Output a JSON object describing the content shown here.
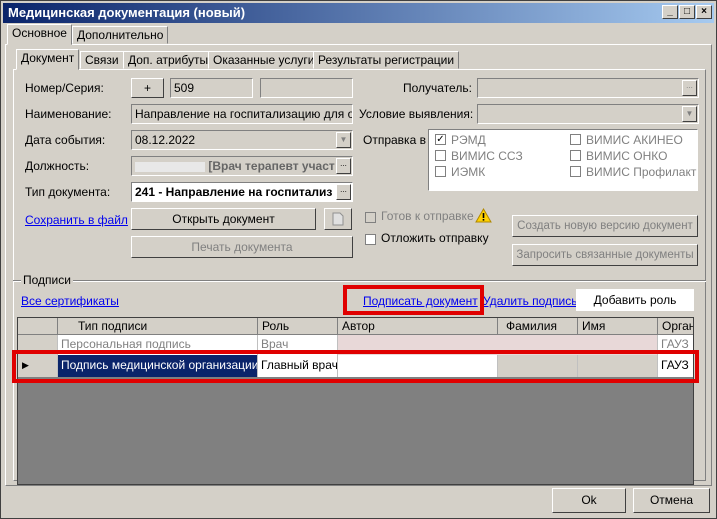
{
  "window": {
    "title": "Медицинская документация (новый)"
  },
  "outer_tabs": [
    "Основное",
    "Дополнительно"
  ],
  "inner_tabs": [
    "Документ",
    "Связи",
    "Доп. атрибуты",
    "Оказанные услуги",
    "Результаты регистрации"
  ],
  "form": {
    "number_label": "Номер/Серия:",
    "plus_label": "+",
    "number_value": "509",
    "name_label": "Наименование:",
    "name_value": "Направление на госпитализацию для оказ",
    "event_date_label": "Дата события:",
    "event_date_value": "08.12.2022",
    "position_label": "Должность:",
    "position_value": "[Врач терапевт участ",
    "doctype_label": "Тип документа:",
    "doctype_value": "241 - Направление на госпитализ",
    "more_label": "...",
    "recipient_label": "Получатель:",
    "condition_label": "Условие выявления:",
    "send_label": "Отправка в"
  },
  "send_targets": [
    {
      "label": "РЭМД",
      "checked": true
    },
    {
      "label": "ВИМИС АКИНЕО",
      "checked": false
    },
    {
      "label": "ВИМИС ССЗ",
      "checked": false
    },
    {
      "label": "ВИМИС ОНКО",
      "checked": false
    },
    {
      "label": "ИЭМК",
      "checked": false
    },
    {
      "label": "ВИМИС Профилактик",
      "checked": false
    }
  ],
  "actions": {
    "save_to_file": "Сохранить в файл",
    "open_doc": "Открыть документ",
    "print_doc": "Печать документа",
    "ready_to_send": "Готов к отправке",
    "postpone_send": "Отложить отправку",
    "create_version": "Создать новую версию документ",
    "request_related": "Запросить связанные документы"
  },
  "signatures": {
    "group_label": "Подписи",
    "all_certs": "Все сертификаты",
    "sign_doc": "Подписать документ",
    "delete_sign": "Удалить подпись",
    "add_role": "Добавить роль",
    "columns": [
      "Тип подписи",
      "Роль",
      "Автор",
      "Фамилия",
      "Имя",
      "Орган"
    ],
    "rows": [
      {
        "type": "Персональная подпись",
        "role": "Врач",
        "author": "",
        "surname": "",
        "name": "",
        "org": "ГАУЗ"
      },
      {
        "type": "Подпись медицинской организации",
        "role": "Главный врач",
        "author": "",
        "surname": "",
        "name": "",
        "org": "ГАУЗ"
      }
    ]
  },
  "footer": {
    "ok": "Ok",
    "cancel": "Отмена"
  },
  "colors": {
    "title_start": "#0a246a",
    "title_end": "#a6caf0",
    "highlight": "#e00000",
    "selected_row": "#0a246a"
  }
}
